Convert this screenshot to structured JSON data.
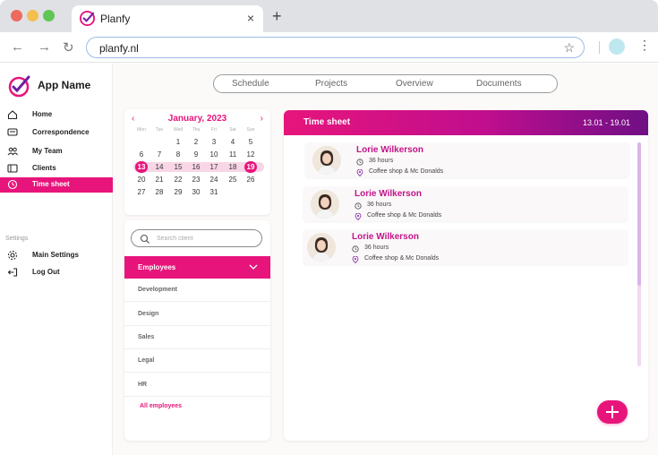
{
  "browser": {
    "tab_title": "Planfy",
    "tab_close": "×",
    "new_tab": "+",
    "url": "planfy.nl",
    "back": "←",
    "forward": "→",
    "reload": "↻",
    "bookmark": "☆",
    "menu": "⋮"
  },
  "app": {
    "name": "App Name",
    "brand_color": "#e7157b"
  },
  "sidebar": {
    "items": [
      {
        "label": "Home",
        "icon": "home-icon"
      },
      {
        "label": "Correspondence",
        "icon": "message-icon"
      },
      {
        "label": "My Team",
        "icon": "team-icon"
      },
      {
        "label": "Clients",
        "icon": "clients-icon"
      },
      {
        "label": "Time sheet",
        "icon": "clock-icon",
        "active": true
      }
    ],
    "settings_caption": "Settings",
    "settings_items": [
      {
        "label": "Main Settings",
        "icon": "gear-icon"
      },
      {
        "label": "Log Out",
        "icon": "logout-icon"
      }
    ]
  },
  "top_tabs": [
    "Schedule",
    "Projects",
    "Overview",
    "Documents"
  ],
  "calendar": {
    "prev": "‹",
    "next": "›",
    "title": "January, 2023",
    "weekdays": [
      "Mon",
      "Tue",
      "Wed",
      "Thu",
      "Fri",
      "Sat",
      "Sun"
    ],
    "weeks": [
      [
        "",
        "",
        "1",
        "2",
        "3",
        "4",
        "5"
      ],
      [
        "6",
        "7",
        "8",
        "9",
        "10",
        "11",
        "12"
      ],
      [
        "13",
        "14",
        "15",
        "16",
        "17",
        "18",
        "19"
      ],
      [
        "20",
        "21",
        "22",
        "23",
        "24",
        "25",
        "26"
      ],
      [
        "27",
        "28",
        "29",
        "30",
        "31",
        "",
        ""
      ]
    ],
    "range_start": "13",
    "range_end": "19"
  },
  "employees": {
    "search_placeholder": "Search client",
    "dropdown_label": "Employees",
    "departments": [
      "Development",
      "Design",
      "Sales",
      "Legal",
      "HR"
    ],
    "all_label": "All employees"
  },
  "timesheet": {
    "title": "Time sheet",
    "range": "13.01 - 19.01",
    "entries": [
      {
        "name": "Lorie Wilkerson",
        "hours": "36 hours",
        "place": "Coffee shop & Mc Donalds"
      },
      {
        "name": "Lorie Wilkerson",
        "hours": "36 hours",
        "place": "Coffee shop & Mc Donalds"
      },
      {
        "name": "Lorie Wilkerson",
        "hours": "36 hours",
        "place": "Coffee shop & Mc Donalds"
      }
    ]
  }
}
